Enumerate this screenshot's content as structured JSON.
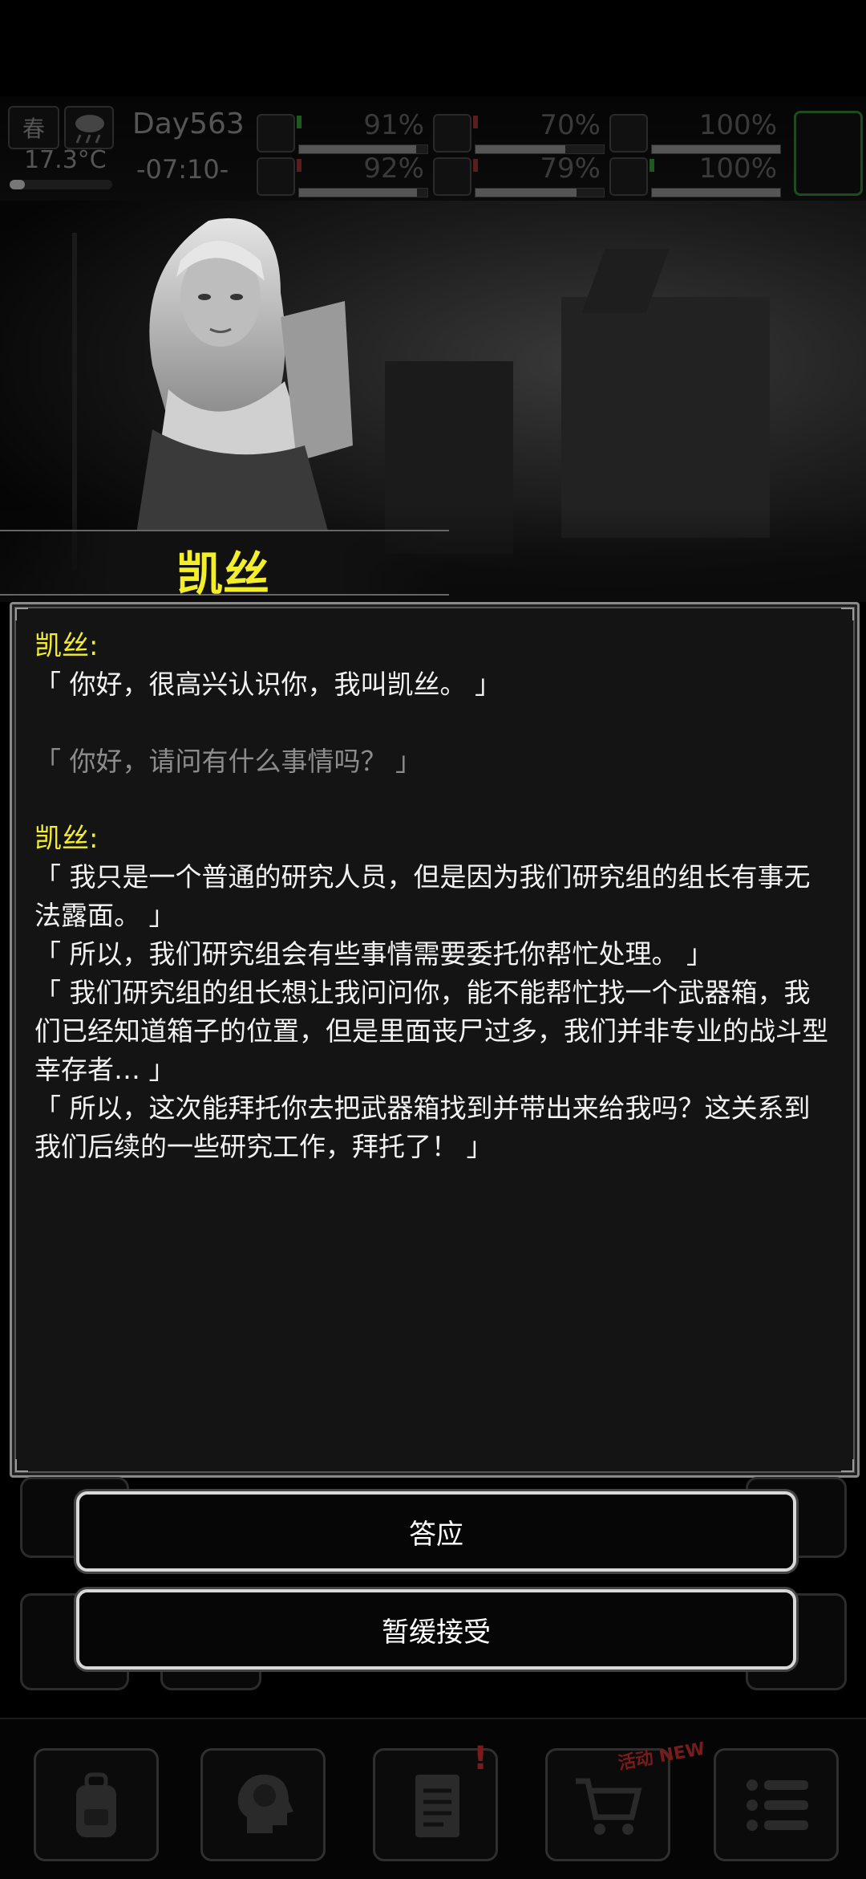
{
  "status": {
    "season": "春",
    "temperature": "17.3°C",
    "temperature_level": 0.15,
    "day": "Day563",
    "time": "-07:10-",
    "stats": [
      {
        "name": "health",
        "icon": "medkit-icon",
        "value": "91%",
        "level": 0.91
      },
      {
        "name": "stamina",
        "icon": "boot-icon",
        "value": "92%",
        "level": 0.92
      },
      {
        "name": "hunger",
        "icon": "stomach-icon",
        "value": "70%",
        "level": 0.7
      },
      {
        "name": "thirst",
        "icon": "water-drop-icon",
        "value": "79%",
        "level": 0.79
      },
      {
        "name": "sleep",
        "icon": "pill-icon",
        "value": "100%",
        "level": 1.0
      },
      {
        "name": "mood",
        "icon": "heart-icon",
        "value": "100%",
        "level": 1.0
      }
    ]
  },
  "character": {
    "name": "凯丝"
  },
  "dialog": {
    "speaker": "凯丝:",
    "block1": [
      "「 你好，很高兴认识你，我叫凯丝。 」"
    ],
    "reply": "「 你好，请问有什么事情吗？ 」",
    "block2": [
      "「 我只是一个普通的研究人员，但是因为我们研究组的组长有事无法露面。 」",
      "「 所以，我们研究组会有些事情需要委托你帮忙处理。 」",
      "「 我们研究组的组长想让我问问你，能不能帮忙找一个武器箱，我们已经知道箱子的位置，但是里面丧尸过多，我们并非专业的战斗型幸存者… 」",
      "「 所以，这次能拜托你去把武器箱找到并带出来给我吗？这关系到我们后续的一些研究工作，拜托了！ 」"
    ]
  },
  "choices": {
    "accept": "答应",
    "postpone": "暂缓接受"
  },
  "nav": {
    "badge_new": "活动 NEW",
    "badge_alert": "!"
  },
  "colors": {
    "speaker": "#f2ee2b",
    "reply": "#8c8c8c",
    "button_border": "#d8d8d8"
  }
}
